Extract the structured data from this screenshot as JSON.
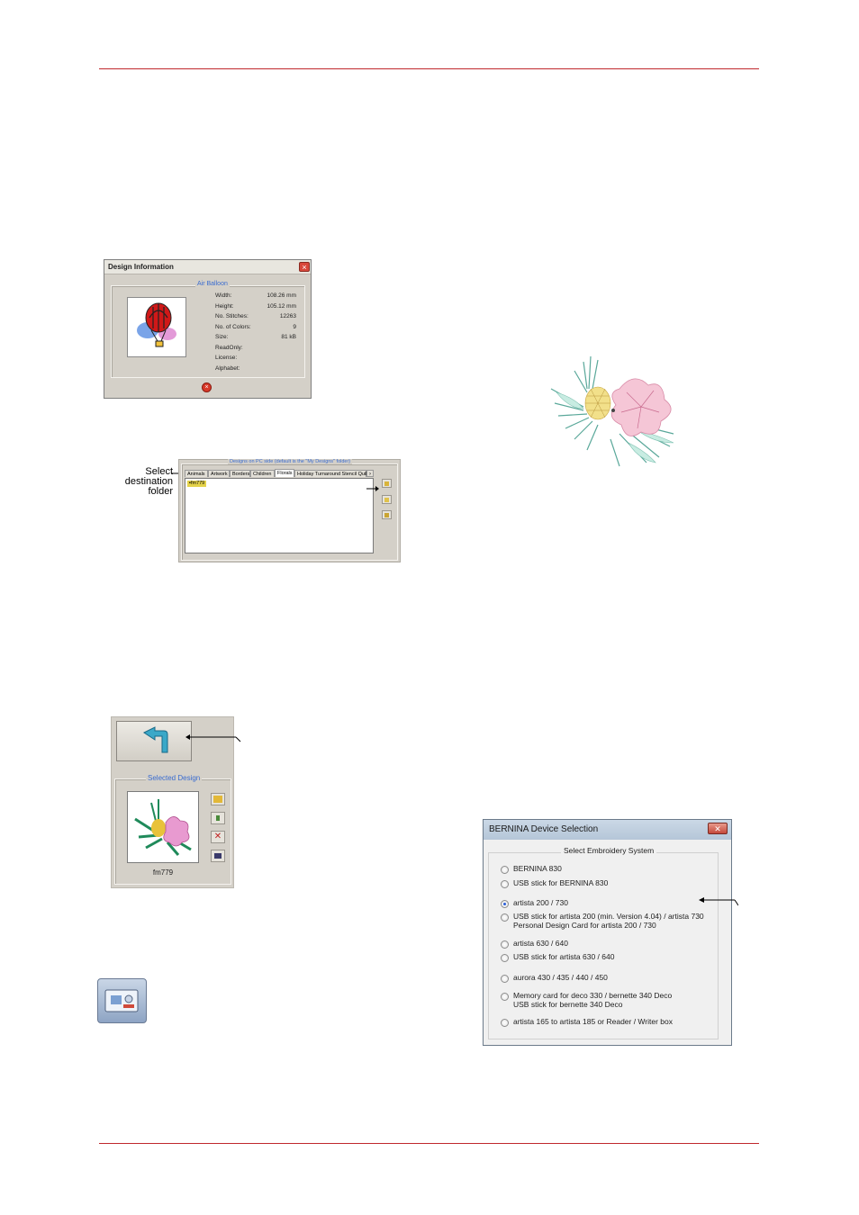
{
  "design_info": {
    "title": "Design Information",
    "design_name": "Air Balloon",
    "rows": [
      {
        "label": "Width:",
        "value": "108.26 mm"
      },
      {
        "label": "Height:",
        "value": "105.12 mm"
      },
      {
        "label": "No. Stitches:",
        "value": "12263"
      },
      {
        "label": "No. of Colors:",
        "value": "9"
      },
      {
        "label": "Size:",
        "value": "81 kB"
      },
      {
        "label": "ReadOnly:",
        "value": ""
      },
      {
        "label": "License:",
        "value": ""
      },
      {
        "label": "Alphabet:",
        "value": ""
      }
    ]
  },
  "folder_panel": {
    "group_title": "Designs on PC side (default is the \"My Designs\" folder)",
    "tabs": [
      "Animals",
      "Artwork",
      "Borders",
      "Children",
      "Florals",
      "Holiday Turnaround Stencil Quil"
    ],
    "active_tab": "Florals",
    "item": "fm779",
    "callout": "Select destination folder"
  },
  "selected_design": {
    "group_title": "Selected Design",
    "name": "fm779"
  },
  "bernina": {
    "title": "BERNINA Device Selection",
    "group_title": "Select Embroidery System",
    "selected_index": 2,
    "options": [
      {
        "line1": "BERNINA 830",
        "line2": ""
      },
      {
        "line1": "USB stick for BERNINA 830",
        "line2": ""
      },
      {
        "line1": "artista 200 / 730",
        "line2": ""
      },
      {
        "line1": "USB stick for artista 200 (min. Version 4.04) / artista 730",
        "line2": "Personal Design Card for artista 200 / 730"
      },
      {
        "line1": "artista 630 / 640",
        "line2": ""
      },
      {
        "line1": "USB stick for artista 630 / 640",
        "line2": ""
      },
      {
        "line1": "aurora 430 / 435 / 440 / 450",
        "line2": ""
      },
      {
        "line1": "Memory card for deco 330 / bernette 340 Deco",
        "line2": "USB stick for bernette 340 Deco"
      },
      {
        "line1": "artista 165 to artista 185 or Reader / Writer  box",
        "line2": ""
      }
    ]
  },
  "colors": {
    "rule": "#c0282d",
    "group_title": "#3a6cd0"
  }
}
